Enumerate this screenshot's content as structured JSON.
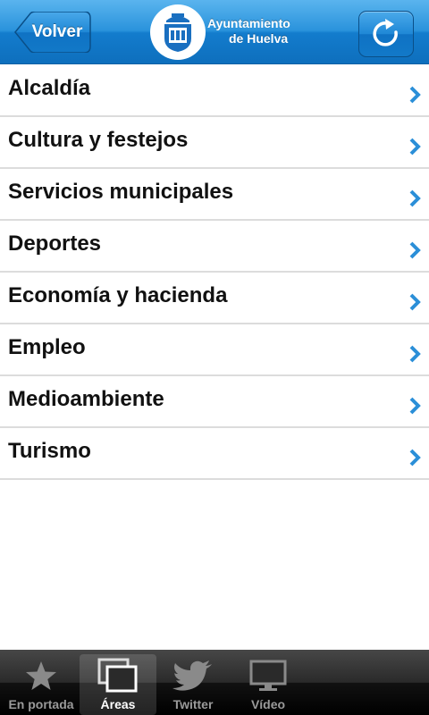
{
  "header": {
    "back_label": "Volver",
    "brand_line1": "Ayuntamiento",
    "brand_line2": "de Huelva"
  },
  "list": {
    "items": [
      {
        "label": "Alcaldía"
      },
      {
        "label": "Cultura y festejos"
      },
      {
        "label": "Servicios municipales"
      },
      {
        "label": "Deportes"
      },
      {
        "label": "Economía y hacienda"
      },
      {
        "label": "Empleo"
      },
      {
        "label": "Medioambiente"
      },
      {
        "label": "Turismo"
      }
    ]
  },
  "tabbar": {
    "tabs": [
      {
        "label": "En portada",
        "icon": "star-icon"
      },
      {
        "label": "Áreas",
        "icon": "windows-icon",
        "active": true
      },
      {
        "label": "Twitter",
        "icon": "bird-icon"
      },
      {
        "label": "Vídeo",
        "icon": "monitor-icon"
      }
    ]
  },
  "colors": {
    "header_blue": "#1a86d6",
    "chevron_blue": "#2b8fd8",
    "tabbar_dark": "#1c1c1c"
  }
}
